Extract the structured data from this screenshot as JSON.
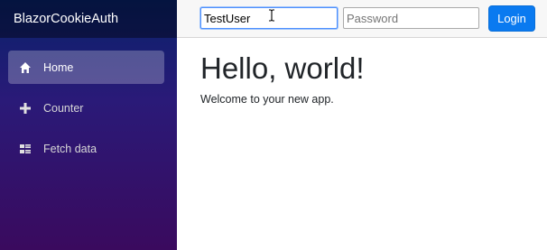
{
  "sidebar": {
    "brand": "BlazorCookieAuth",
    "items": [
      {
        "label": "Home",
        "icon": "home-icon",
        "active": true
      },
      {
        "label": "Counter",
        "icon": "plus-icon",
        "active": false
      },
      {
        "label": "Fetch data",
        "icon": "list-rich-icon",
        "active": false
      }
    ]
  },
  "topbar": {
    "username_value": "TestUser",
    "password_placeholder": "Password",
    "login_label": "Login"
  },
  "main": {
    "heading": "Hello, world!",
    "text": "Welcome to your new app."
  },
  "colors": {
    "login_button": "#0a7af0",
    "sidebar_top": "#08226b",
    "sidebar_bottom": "#3a0a5e"
  }
}
